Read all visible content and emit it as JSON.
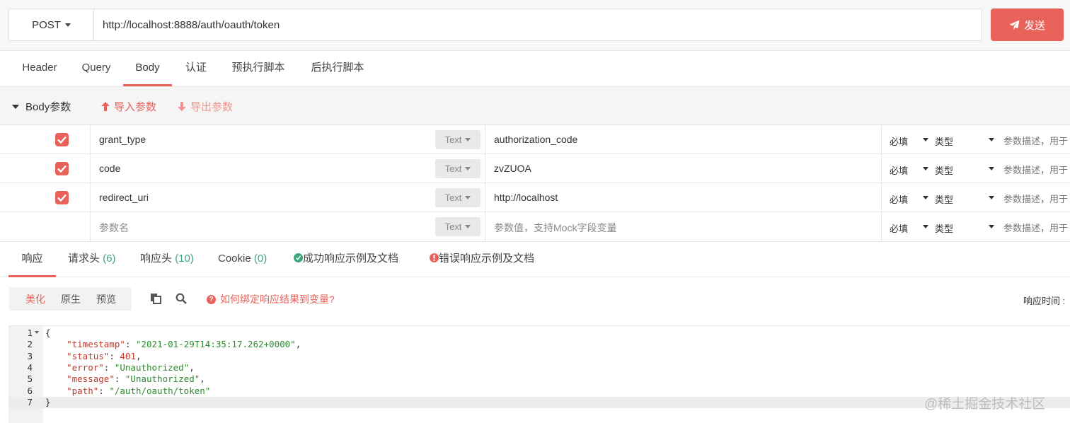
{
  "request": {
    "method": "POST",
    "url": "http://localhost:8888/auth/oauth/token",
    "send_label": "发送"
  },
  "request_tabs": [
    "Header",
    "Query",
    "Body",
    "认证",
    "预执行脚本",
    "后执行脚本"
  ],
  "active_request_tab": "Body",
  "body_params": {
    "title": "Body参数",
    "import_label": "导入参数",
    "export_label": "导出参数",
    "rows": [
      {
        "checked": true,
        "name": "grant_type",
        "type": "Text",
        "value": "authorization_code",
        "required": "必填",
        "data_type": "类型",
        "description": "参数描述，用于"
      },
      {
        "checked": true,
        "name": "code",
        "type": "Text",
        "value": "zvZUOA",
        "required": "必填",
        "data_type": "类型",
        "description": "参数描述，用于"
      },
      {
        "checked": true,
        "name": "redirect_uri",
        "type": "Text",
        "value": "http://localhost",
        "required": "必填",
        "data_type": "类型",
        "description": "参数描述，用于"
      }
    ],
    "empty_row": {
      "name_placeholder": "参数名",
      "type": "Text",
      "value_placeholder": "参数值，支持Mock字段变量",
      "required": "必填",
      "data_type": "类型",
      "description": "参数描述，用于"
    }
  },
  "response_tabs": [
    {
      "label": "响应",
      "count": ""
    },
    {
      "label": "请求头",
      "count": "(6)"
    },
    {
      "label": "响应头",
      "count": "(10)"
    },
    {
      "label": "Cookie",
      "count": "(0)"
    },
    {
      "label": "成功响应示例及文档",
      "count": ""
    },
    {
      "label": "错误响应示例及文档",
      "count": ""
    }
  ],
  "response_toolbar": {
    "view_modes": [
      "美化",
      "原生",
      "预览"
    ],
    "active_view": "美化",
    "help_text": "如何绑定响应结果到变量?",
    "help_icon_glyph": "?",
    "response_time_label": "响应时间 :"
  },
  "code": {
    "line_numbers": [
      "1",
      "2",
      "3",
      "4",
      "5",
      "6",
      "7"
    ],
    "open_brace": "{",
    "close_brace": "}",
    "lines": [
      {
        "key": "\"timestamp\"",
        "value": "\"2021-01-29T14:35:17.262+0000\"",
        "value_type": "string",
        "comma": ","
      },
      {
        "key": "\"status\"",
        "value": "401",
        "value_type": "number",
        "comma": ","
      },
      {
        "key": "\"error\"",
        "value": "\"Unauthorized\"",
        "value_type": "string",
        "comma": ","
      },
      {
        "key": "\"message\"",
        "value": "\"Unauthorized\"",
        "value_type": "string",
        "comma": ","
      },
      {
        "key": "\"path\"",
        "value": "\"/auth/oauth/token\"",
        "value_type": "string",
        "comma": ""
      }
    ]
  },
  "watermark": "@稀土掘金技术社区",
  "colors": {
    "accent": "#e8625a",
    "success": "#3aa67a",
    "json_key": "#c0392b",
    "json_string": "#2e8b2e"
  }
}
